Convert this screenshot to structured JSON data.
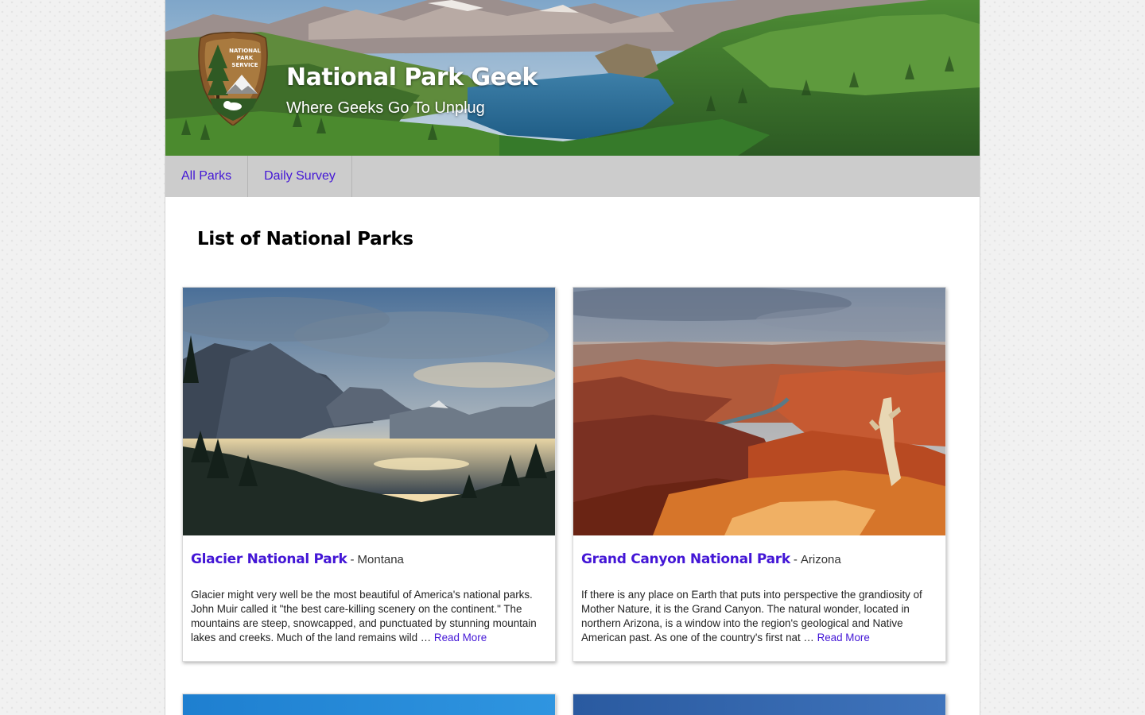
{
  "site": {
    "title": "National Park Geek",
    "tagline": "Where Geeks Go To Unplug",
    "logo_text": "NATIONAL PARK SERVICE"
  },
  "nav": {
    "items": [
      {
        "label": "All Parks"
      },
      {
        "label": "Daily Survey"
      }
    ]
  },
  "main": {
    "heading": "List of National Parks",
    "parks": [
      {
        "name": "Glacier National Park",
        "separator": "-",
        "state": "Montana",
        "description": "Glacier might very well be the most beautiful of America's national parks. John Muir called it \"the best care-killing scenery on the continent.\" The mountains are steep, snowcapped, and punctuated by stunning mountain lakes and creeks. Much of the land remains wild …",
        "read_more": "Read More"
      },
      {
        "name": "Grand Canyon National Park",
        "separator": "-",
        "state": "Arizona",
        "description": "If there is any place on Earth that puts into perspective the grandiosity of Mother Nature, it is the Grand Canyon. The natural wonder, located in northern Arizona, is a window into the region's geological and Native American past. As one of the country's first nat …",
        "read_more": "Read More"
      }
    ]
  },
  "colors": {
    "link": "#4316d6",
    "nav_background": "#cccccc",
    "page_background": "#f1f1f1"
  }
}
